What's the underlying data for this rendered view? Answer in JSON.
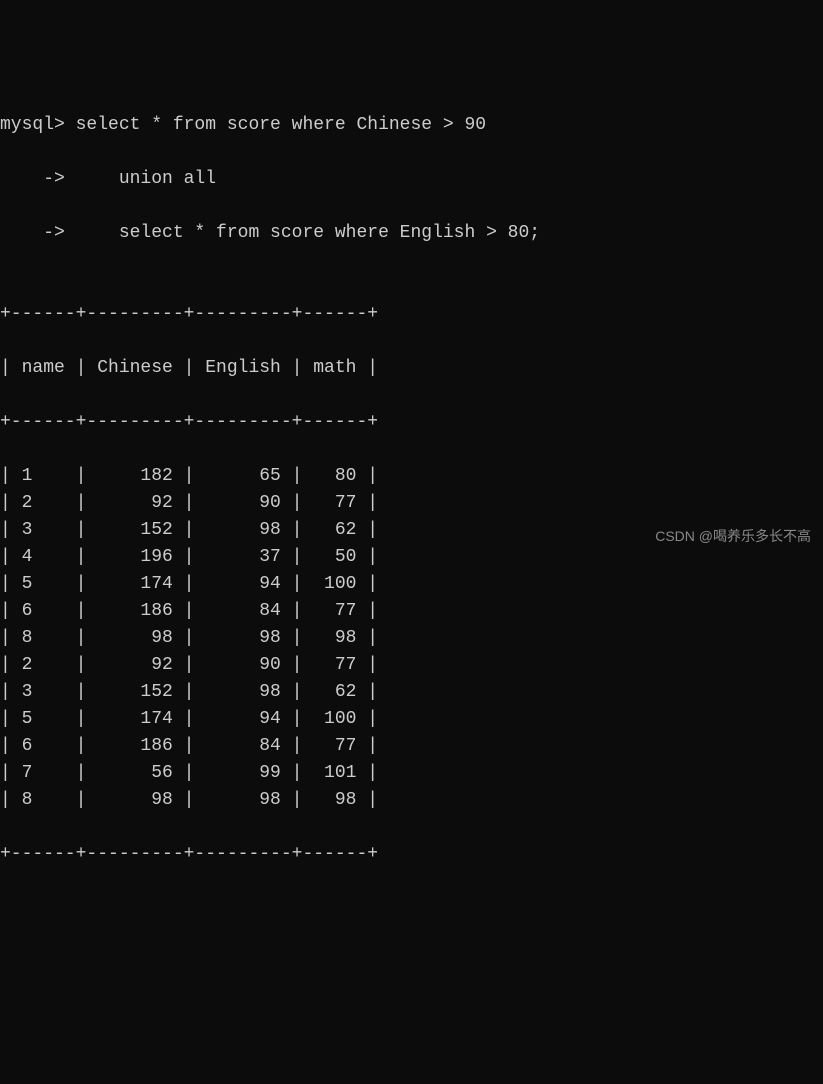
{
  "prompt": {
    "line1_prefix": "mysql>",
    "line1_sql": " select * from score where Chinese > 90",
    "line2_prefix": "    ->",
    "line2_sql": "     union all",
    "line3_prefix": "    ->",
    "line3_sql": "     select * from score where English > 80;"
  },
  "table": {
    "border_top": "+------+---------+---------+------+",
    "headers": [
      "name",
      "Chinese",
      "English",
      "math"
    ],
    "header_line": "| name | Chinese | English | math |",
    "separator": "+------+---------+---------+------+",
    "rows": [
      {
        "name": "1",
        "Chinese": "182",
        "English": "65",
        "math": "80"
      },
      {
        "name": "2",
        "Chinese": "92",
        "English": "90",
        "math": "77"
      },
      {
        "name": "3",
        "Chinese": "152",
        "English": "98",
        "math": "62"
      },
      {
        "name": "4",
        "Chinese": "196",
        "English": "37",
        "math": "50"
      },
      {
        "name": "5",
        "Chinese": "174",
        "English": "94",
        "math": "100"
      },
      {
        "name": "6",
        "Chinese": "186",
        "English": "84",
        "math": "77"
      },
      {
        "name": "8",
        "Chinese": "98",
        "English": "98",
        "math": "98"
      },
      {
        "name": "2",
        "Chinese": "92",
        "English": "90",
        "math": "77"
      },
      {
        "name": "3",
        "Chinese": "152",
        "English": "98",
        "math": "62"
      },
      {
        "name": "5",
        "Chinese": "174",
        "English": "94",
        "math": "100"
      },
      {
        "name": "6",
        "Chinese": "186",
        "English": "84",
        "math": "77"
      },
      {
        "name": "7",
        "Chinese": "56",
        "English": "99",
        "math": "101"
      },
      {
        "name": "8",
        "Chinese": "98",
        "English": "98",
        "math": "98"
      }
    ],
    "border_bottom": "+------+---------+---------+------+"
  },
  "watermark": "CSDN @喝养乐多长不高"
}
